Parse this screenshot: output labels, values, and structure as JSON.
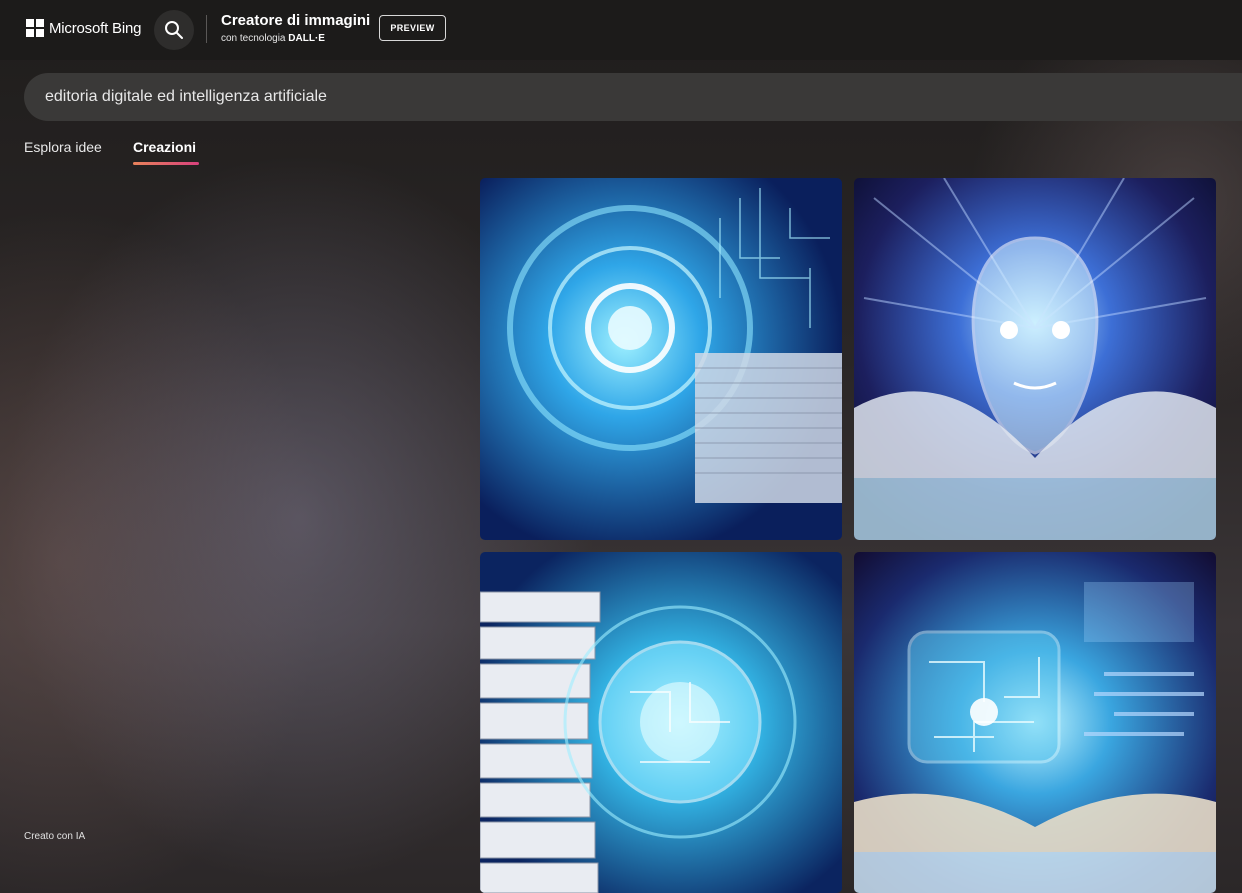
{
  "header": {
    "brand": "Microsoft Bing",
    "title": "Creatore di immagini",
    "subtitle_prefix": "con tecnologia ",
    "subtitle_brand": "DALL·E",
    "preview_label": "PREVIEW"
  },
  "search": {
    "query": "editoria digitale ed intelligenza artificiale"
  },
  "tabs": [
    {
      "label": "Esplora idee",
      "active": false
    },
    {
      "label": "Creazioni",
      "active": true
    }
  ],
  "credit": "Creato con IA",
  "icons": {
    "brand": "microsoft-logo-icon",
    "search": "search-icon"
  },
  "colors": {
    "background": "#1c1b1a",
    "search_bar": "#3a3938",
    "tab_accent_start": "#e8825b",
    "tab_accent_end": "#d8417d",
    "image_glow": "#4fd2ff"
  }
}
